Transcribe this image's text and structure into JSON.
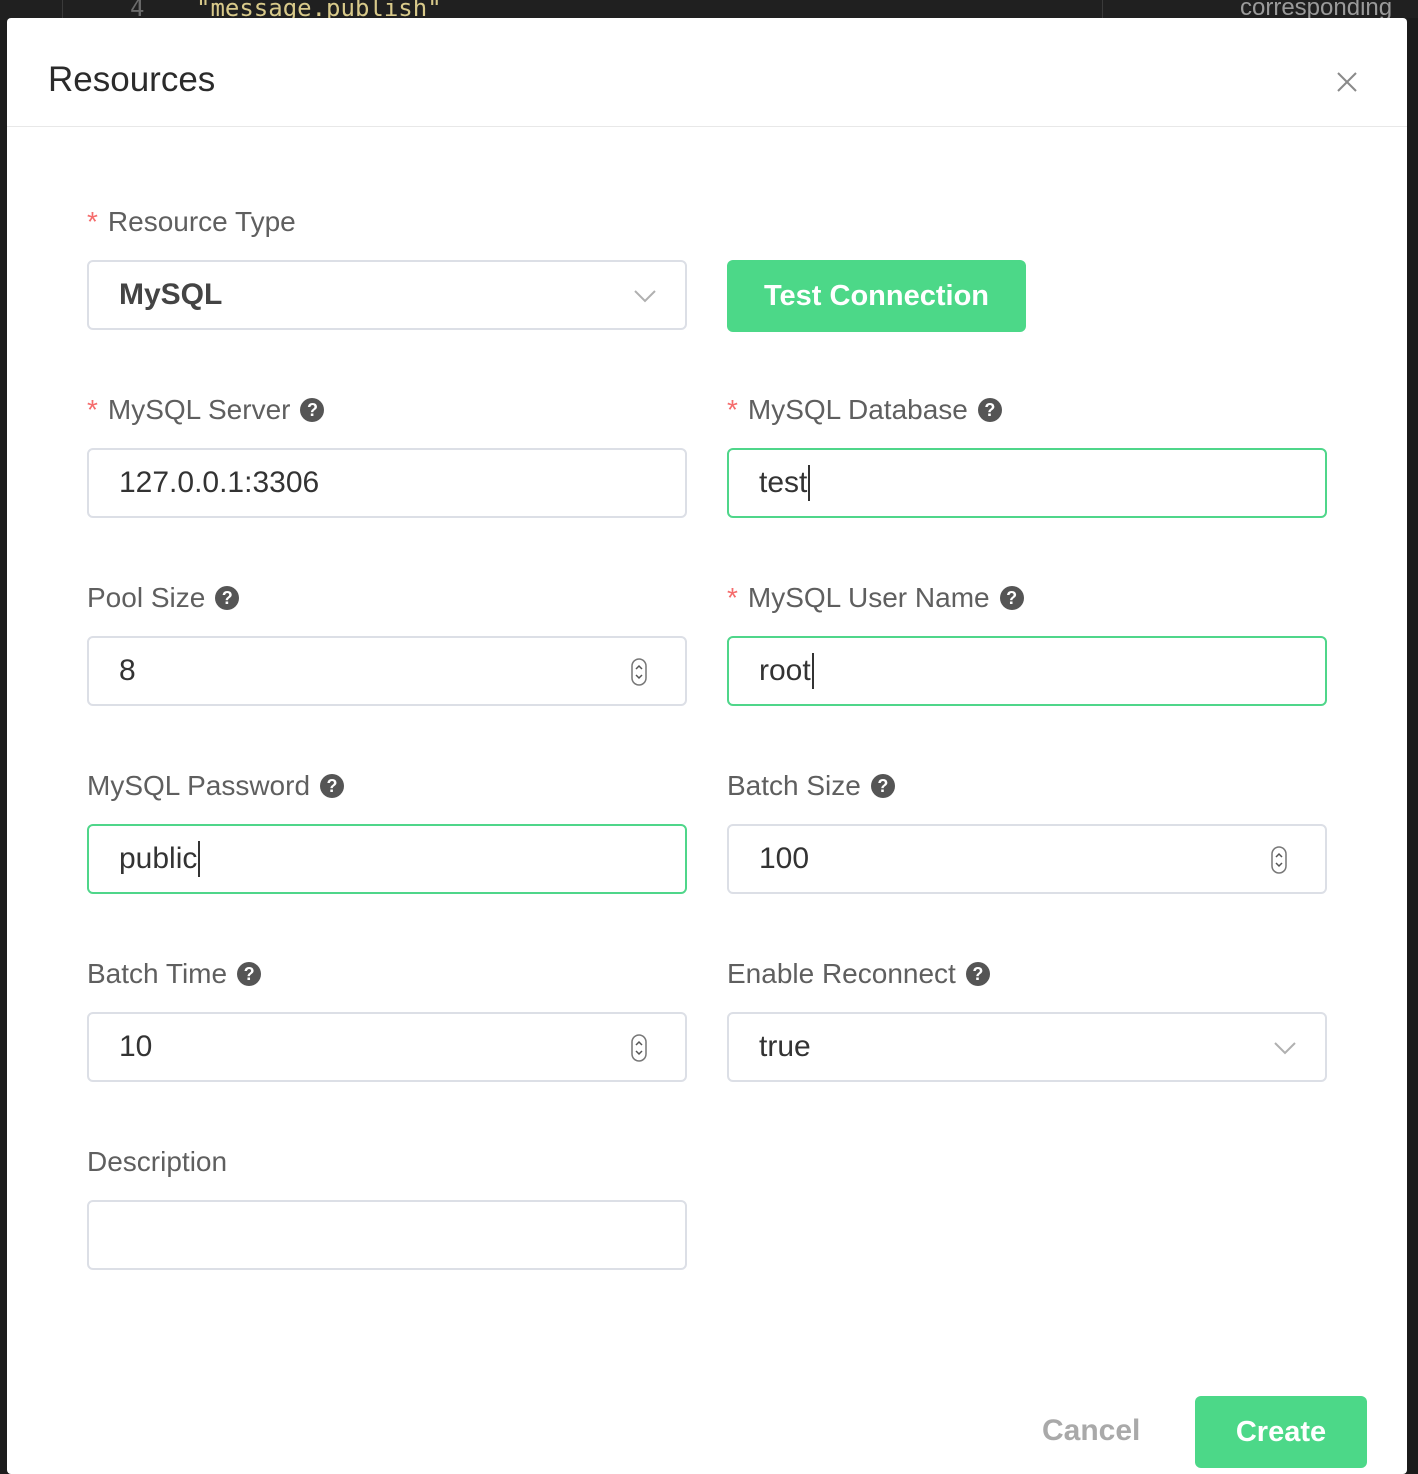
{
  "background": {
    "line_number": "4",
    "code_snippet": "\"message.publish\"",
    "side_text": "corresponding"
  },
  "modal": {
    "title": "Resources",
    "close_icon": "close-icon"
  },
  "form": {
    "resource_type": {
      "label": "Resource Type",
      "value": "MySQL",
      "required": "*"
    },
    "test_connection_label": "Test Connection",
    "mysql_server": {
      "label": "MySQL Server",
      "value": "127.0.0.1:3306",
      "required": "*"
    },
    "mysql_database": {
      "label": "MySQL Database",
      "value": "test",
      "required": "*"
    },
    "pool_size": {
      "label": "Pool Size",
      "value": "8"
    },
    "mysql_user_name": {
      "label": "MySQL User Name",
      "value": "root",
      "required": "*"
    },
    "mysql_password": {
      "label": "MySQL Password",
      "value": "public"
    },
    "batch_size": {
      "label": "Batch Size",
      "value": "100"
    },
    "batch_time": {
      "label": "Batch Time",
      "value": "10"
    },
    "enable_reconnect": {
      "label": "Enable Reconnect",
      "value": "true"
    },
    "description": {
      "label": "Description",
      "value": ""
    },
    "help_glyph": "?"
  },
  "footer": {
    "cancel_label": "Cancel",
    "create_label": "Create"
  },
  "colors": {
    "accent": "#4cd888",
    "required": "#f56c6c",
    "focus_border": "#4fd68a"
  }
}
